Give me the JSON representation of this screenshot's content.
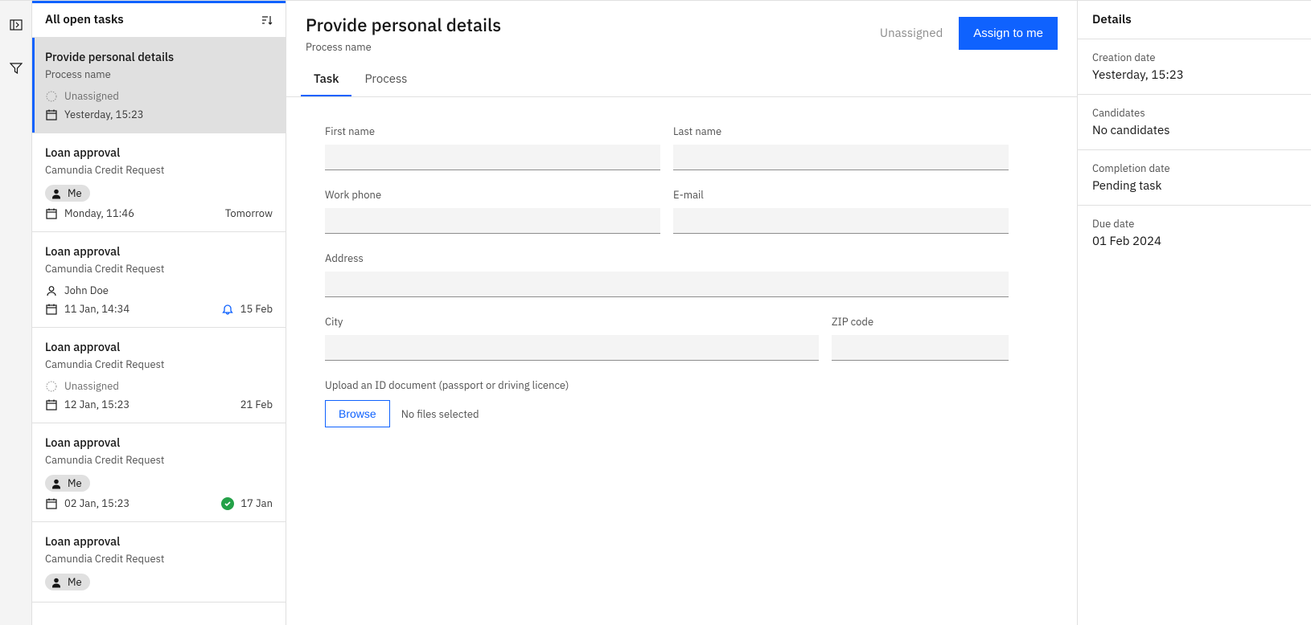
{
  "sidebar": {
    "heading": "All open tasks"
  },
  "tasks": [
    {
      "title": "Provide personal details",
      "process": "Process name",
      "assignee_type": "unassigned",
      "assignee_label": "Unassigned",
      "date": "Yesterday, 15:23",
      "due": "",
      "due_icon": "",
      "selected": true
    },
    {
      "title": "Loan approval",
      "process": "Camundia Credit Request",
      "assignee_type": "me",
      "assignee_label": "Me",
      "date": "Monday, 11:46",
      "due": "Tomorrow",
      "due_icon": "",
      "selected": false
    },
    {
      "title": "Loan approval",
      "process": "Camundia Credit Request",
      "assignee_type": "user",
      "assignee_label": "John Doe",
      "date": "11 Jan, 14:34",
      "due": "15 Feb",
      "due_icon": "bell",
      "selected": false
    },
    {
      "title": "Loan approval",
      "process": "Camundia Credit Request",
      "assignee_type": "unassigned",
      "assignee_label": "Unassigned",
      "date": "12 Jan, 15:23",
      "due": "21 Feb",
      "due_icon": "",
      "selected": false
    },
    {
      "title": "Loan approval",
      "process": "Camundia Credit Request",
      "assignee_type": "me",
      "assignee_label": "Me",
      "date": "02 Jan, 15:23",
      "due": "17 Jan",
      "due_icon": "check",
      "selected": false
    },
    {
      "title": "Loan approval",
      "process": "Camundia Credit Request",
      "assignee_type": "me",
      "assignee_label": "Me",
      "date": "",
      "due": "",
      "due_icon": "",
      "selected": false
    }
  ],
  "main": {
    "title": "Provide personal details",
    "subtitle": "Process name",
    "unassigned_label": "Unassigned",
    "assign_button": "Assign to me",
    "tabs": [
      {
        "label": "Task",
        "active": true
      },
      {
        "label": "Process",
        "active": false
      }
    ],
    "form": {
      "first_name_label": "First name",
      "last_name_label": "Last name",
      "work_phone_label": "Work phone",
      "email_label": "E-mail",
      "address_label": "Address",
      "city_label": "City",
      "zip_label": "ZIP code",
      "upload_label": "Upload an ID document (passport or driving licence)",
      "browse_button": "Browse",
      "upload_status": "No files selected"
    }
  },
  "details": {
    "title": "Details",
    "creation_label": "Creation date",
    "creation_value": "Yesterday, 15:23",
    "candidates_label": "Candidates",
    "candidates_value": "No candidates",
    "completion_label": "Completion date",
    "completion_value": "Pending task",
    "due_label": "Due date",
    "due_value": "01 Feb 2024"
  }
}
